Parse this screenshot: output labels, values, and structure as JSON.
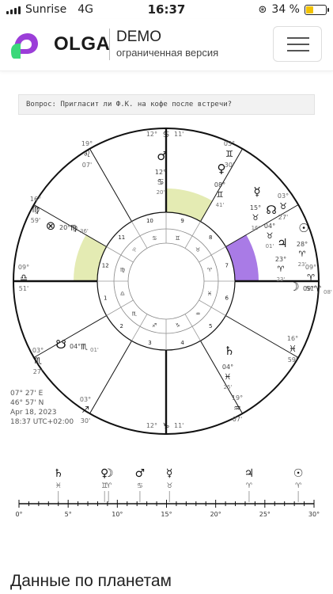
{
  "status_bar": {
    "carrier": "Sunrise",
    "network": "4G",
    "time": "16:37",
    "battery": "34 %"
  },
  "header": {
    "brand": "OLGA",
    "demo": "DEMO",
    "demo_sub": "ограниченная версия"
  },
  "question": "Вопрос: Пригласит ли Ф.К. на кофе после встречи?",
  "chart_info": {
    "longitude": "07° 27' E",
    "latitude": "46° 57' N",
    "date": "Apr 18, 2023",
    "time": "18:37 UTC+02:00"
  },
  "cusps": [
    {
      "deg": "12°",
      "sign": "♋",
      "min": "11'"
    },
    {
      "deg": "03°",
      "sign": "♊",
      "min": "30'"
    },
    {
      "deg": "03°",
      "sign": "♉",
      "min": "27'"
    },
    {
      "deg": "09°",
      "sign": "♈",
      "min": "51'"
    },
    {
      "deg": "16°",
      "sign": "♓",
      "min": "59'"
    },
    {
      "deg": "19°",
      "sign": "♒",
      "min": "07'"
    },
    {
      "deg": "12°",
      "sign": "♑",
      "min": "11'"
    },
    {
      "deg": "03°",
      "sign": "♐",
      "min": "30'"
    },
    {
      "deg": "03°",
      "sign": "♏",
      "min": "27'"
    },
    {
      "deg": "09°",
      "sign": "♎",
      "min": "51'"
    },
    {
      "deg": "16°",
      "sign": "♍",
      "min": "59'"
    },
    {
      "deg": "19°",
      "sign": "♌",
      "min": "07'"
    }
  ],
  "planets": [
    {
      "glyph": "♂",
      "deg": "12°",
      "sign": "♋",
      "min": "20'"
    },
    {
      "glyph": "♀",
      "deg": "08°",
      "sign": "♊",
      "min": "41'"
    },
    {
      "glyph": "☿",
      "deg": "15°",
      "sign": "♉",
      "min": "16'"
    },
    {
      "glyph": "☊",
      "deg": "04°",
      "sign": "♉",
      "min": "01'"
    },
    {
      "glyph": "☉",
      "deg": "28°",
      "sign": "♈",
      "min": "23'"
    },
    {
      "glyph": "♃",
      "deg": "23°",
      "sign": "♈",
      "min": "23'"
    },
    {
      "glyph": "☽",
      "deg": "09°",
      "sign": "♈",
      "min": "08'"
    },
    {
      "glyph": "♄",
      "deg": "04°",
      "sign": "♓",
      "min": "25'"
    },
    {
      "glyph": "☋",
      "deg": "04°",
      "sign": "♏",
      "min": "01'"
    },
    {
      "glyph": "⊗",
      "deg": "20°",
      "sign": "♍",
      "min": "36'"
    }
  ],
  "houses": [
    "1",
    "2",
    "3",
    "4",
    "5",
    "6",
    "7",
    "8",
    "9",
    "10",
    "11",
    "12"
  ],
  "zodiac": [
    "♈",
    "♉",
    "♊",
    "♋",
    "♌",
    "♍",
    "♎",
    "♏",
    "♐",
    "♑",
    "♒",
    "♓"
  ],
  "ruler": {
    "ticks": [
      "0°",
      "5°",
      "10°",
      "15°",
      "20°",
      "25°",
      "30°"
    ],
    "items": [
      {
        "glyph": "♄",
        "sign": "♓",
        "deg": 4
      },
      {
        "glyph": "♀",
        "sign": "♊",
        "deg": 8.7
      },
      {
        "glyph": "☽",
        "sign": "♈",
        "deg": 9.1
      },
      {
        "glyph": "♂",
        "sign": "♋",
        "deg": 12.3
      },
      {
        "glyph": "☿",
        "sign": "♉",
        "deg": 15.3
      },
      {
        "glyph": "♃",
        "sign": "♈",
        "deg": 23.4
      },
      {
        "glyph": "☉",
        "sign": "♈",
        "deg": 28.4
      }
    ]
  },
  "section_title": "Данные по планетам",
  "colors": {
    "highlight_green": "#e4ebb3",
    "highlight_purple": "#a97be6",
    "logo_purple": "#9b3ed8",
    "logo_green": "#3bd87a"
  }
}
